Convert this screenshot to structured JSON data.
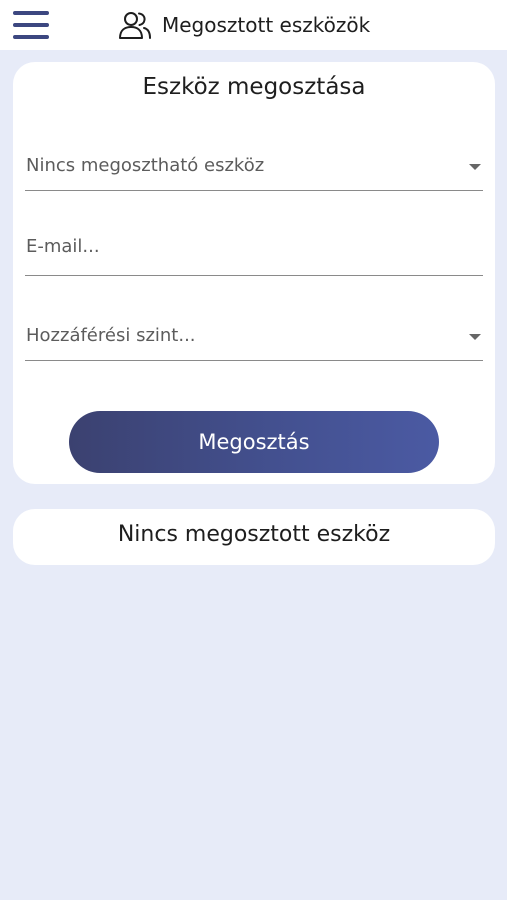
{
  "header": {
    "title": "Megosztott eszközök",
    "menu_icon": "hamburger-menu-icon",
    "title_icon": "users-icon",
    "accent_color": "#3c4780"
  },
  "share_form": {
    "title": "Eszköz megosztása",
    "device_select": {
      "value": "Nincs megosztható eszköz",
      "icon": "chevron-down-icon"
    },
    "email": {
      "value": "",
      "placeholder": "E-mail..."
    },
    "access_level_select": {
      "placeholder": "Hozzáférési szint...",
      "icon": "chevron-down-icon"
    },
    "share_button_label": "Megosztás",
    "button_gradient": [
      "#3b4170",
      "#4b5aa3"
    ]
  },
  "shared_list": {
    "empty_text": "Nincs megosztott eszköz"
  },
  "colors": {
    "background": "#e7ebf8",
    "card": "#ffffff"
  }
}
